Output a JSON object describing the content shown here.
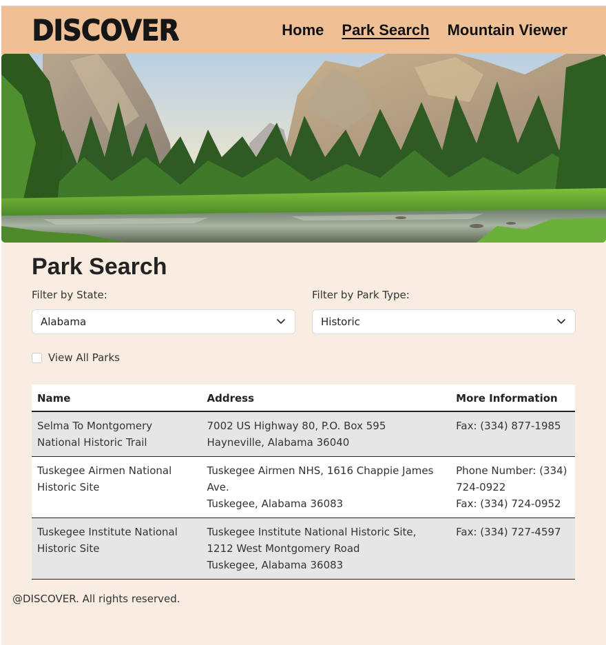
{
  "header": {
    "brand": "DISCOVER",
    "nav": [
      {
        "label": "Home"
      },
      {
        "label": "Park Search"
      },
      {
        "label": "Mountain Viewer"
      }
    ]
  },
  "main": {
    "title": "Park Search",
    "filters": {
      "state_label": "Filter by State:",
      "state_value": "Alabama",
      "type_label": "Filter by Park Type:",
      "type_value": "Historic",
      "view_all_label": "View All Parks",
      "view_all_checked": false
    },
    "table": {
      "headers": [
        "Name",
        "Address",
        "More Information"
      ],
      "rows": [
        {
          "name": "Selma To Montgomery National Historic Trail",
          "address_line1": "7002 US Highway 80, P.O. Box 595",
          "address_line2": "Hayneville, Alabama 36040",
          "info_line1": "Fax: (334) 877-1985",
          "info_line2": ""
        },
        {
          "name": "Tuskegee Airmen National Historic Site",
          "address_line1": "Tuskegee Airmen NHS, 1616 Chappie James Ave.",
          "address_line2": "Tuskegee, Alabama 36083",
          "info_line1": "Phone Number: (334) 724-0922",
          "info_line2": "Fax: (334) 724-0952"
        },
        {
          "name": "Tuskegee Institute National Historic Site",
          "address_line1": "Tuskegee Institute National Historic Site, 1212 West Montgomery Road",
          "address_line2": "Tuskegee, Alabama 36083",
          "info_line1": "Fax: (334) 727-4597",
          "info_line2": ""
        }
      ]
    }
  },
  "footer": {
    "text": "@DISCOVER. All rights reserved."
  },
  "colors": {
    "navbar": "#efbf96",
    "page_background": "#f8ede0",
    "striped_row": "#e6e6e6"
  },
  "icons": {
    "select_arrow": "chevron-down-icon",
    "hero": "valley-landscape-image"
  }
}
